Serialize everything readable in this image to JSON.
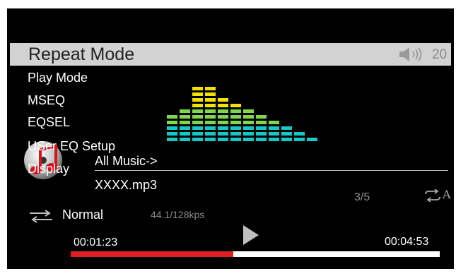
{
  "header": {
    "title": "Repeat Mode",
    "volume": "20",
    "volume_icon": "speaker-icon"
  },
  "menu": {
    "items": [
      "Play Mode",
      "MSEQ",
      "EQSEL",
      "USer EQ Setup",
      "Display"
    ]
  },
  "equalizer": {
    "levels": [
      5,
      6,
      10,
      10,
      8,
      7,
      6,
      5,
      4,
      3,
      2,
      1
    ],
    "max_level": 10,
    "colors": {
      "top": "#f2e200",
      "middle": "#7fd84a",
      "bottom": "#14c8c8"
    }
  },
  "track": {
    "breadcrumb": "All Music->",
    "filename": "XXXX.mp3",
    "index": "3/5",
    "repeat_label": "A",
    "mode": "Normal",
    "bitrate": "44.1/128kps",
    "elapsed": "00:01:23",
    "total": "00:04:53",
    "progress_fraction": 0.44
  },
  "colors": {
    "background": "#000000",
    "titlebar": "#d2d2d2",
    "progress": "#e02020"
  }
}
